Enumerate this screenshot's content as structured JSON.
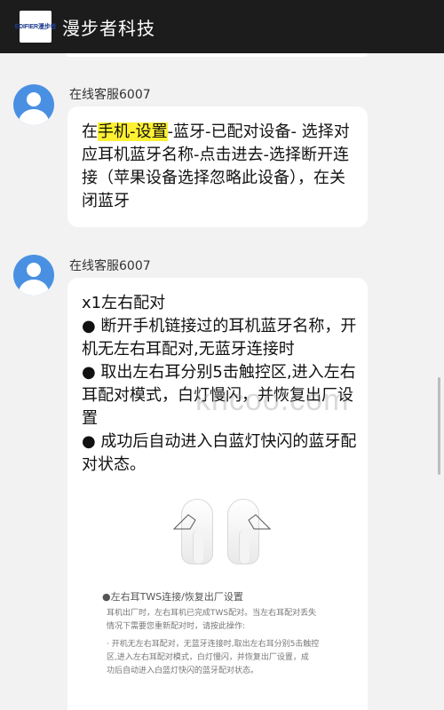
{
  "header": {
    "logo_text": "EDIFIER漫步者",
    "title": "漫步者科技"
  },
  "messages": [
    {
      "sender": "在线客服6007",
      "lines": [
        [
          "在",
          "手机-设置",
          "-蓝牙-已配对设备- 选择对"
        ],
        [
          "应耳机蓝牙名称-点击进去-选择断开连"
        ],
        [
          "接（苹果设备选择忽略此设备），在关"
        ],
        [
          "闭蓝牙"
        ]
      ]
    },
    {
      "sender": "在线客服6007",
      "lines": [
        "x1左右配对",
        "● 断开手机链接过的耳机蓝牙名称，开",
        "机无左右耳配对,无蓝牙连接时",
        "● 取出左右耳分别5击触控区,进入左右",
        "耳配对模式，白灯慢闪，并恢复出厂设",
        "置",
        "● 成功后自动进入白蓝灯快闪的蓝牙配",
        "对状态。"
      ],
      "image": {
        "caption_title": "●左右耳TWS连接/恢复出厂设置",
        "caption_lines": [
          "耳机出厂时，左右耳机已完成TWS配对。当左右耳配对丢失",
          "情况下需要您重新配对时，请按此操作:",
          "·  开机无左右耳配对，无蓝牙连接时,取出左右耳分别5击触控",
          "   区,进入左右耳配对模式，白灯慢闪，并恢复出厂设置，成",
          "   功后自动进入白蓝灯快闪的蓝牙配对状态。"
        ]
      }
    }
  ],
  "watermark": "khcoo.com"
}
